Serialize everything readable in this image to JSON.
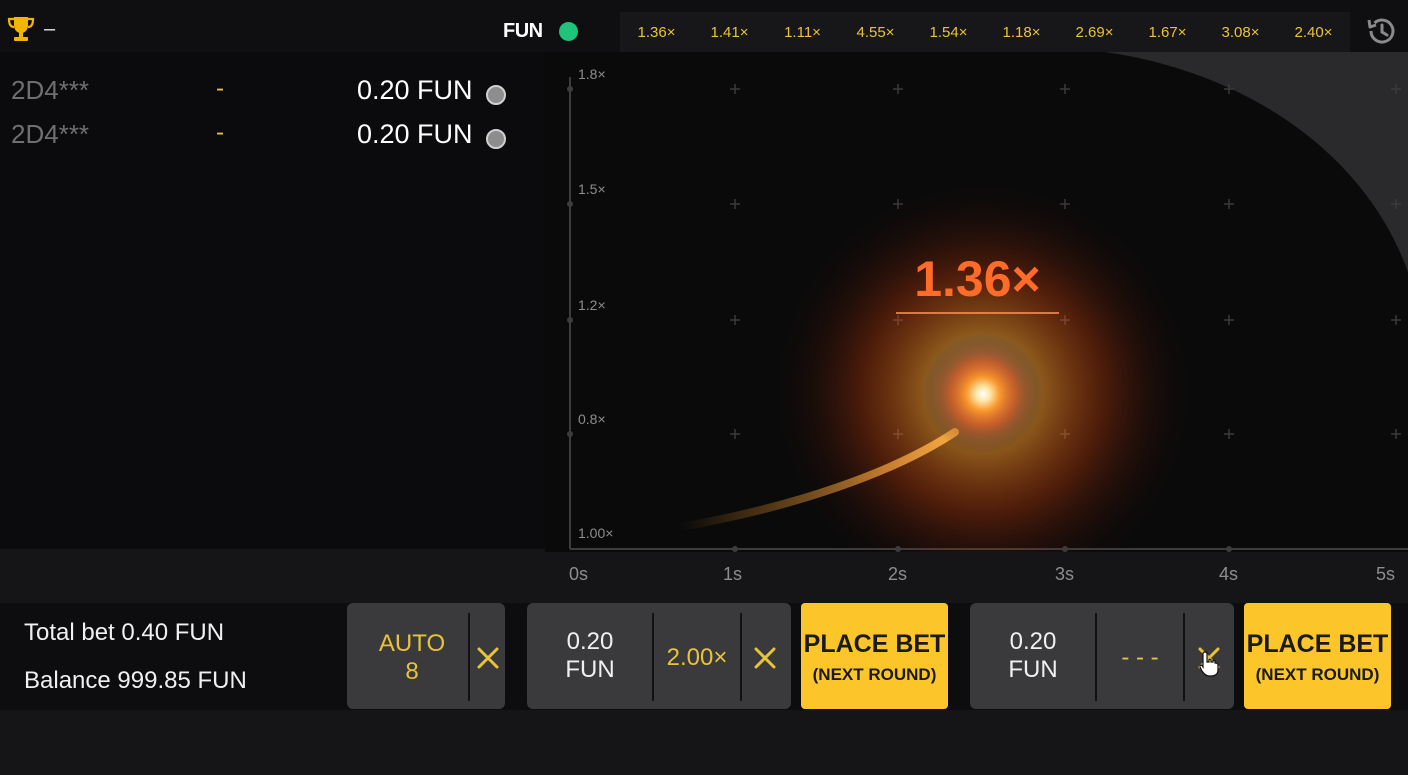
{
  "header": {
    "top_dash": "–",
    "currency": "FUN",
    "history": [
      "1.36×",
      "1.41×",
      "1.11×",
      "4.55×",
      "1.54×",
      "1.18×",
      "2.69×",
      "1.67×",
      "3.08×",
      "2.40×"
    ],
    "icons": [
      "trophy-icon",
      "history-icon"
    ],
    "online_color": "#1ec47a"
  },
  "bets": [
    {
      "user": "2D4***",
      "cashout": "-",
      "amount": "0.20 FUN"
    },
    {
      "user": "2D4***",
      "cashout": "-",
      "amount": "0.20 FUN"
    }
  ],
  "graph": {
    "multiplier": "1.36×",
    "y_labels": [
      "1.8×",
      "1.5×",
      "1.2×",
      "0.8×",
      "1.00×"
    ],
    "x_labels": [
      "0s",
      "1s",
      "2s",
      "3s",
      "4s",
      "5s"
    ],
    "accent_color": "#ff6c2a"
  },
  "footer": {
    "total_bet": "Total bet 0.40 FUN",
    "balance": "Balance 999.85 FUN",
    "auto_label": "AUTO",
    "auto_count": "8",
    "bet1_amount_line1": "0.20",
    "bet1_amount_line2": "FUN",
    "bet1_autocashout": "2.00×",
    "bet2_amount_line1": "0.20",
    "bet2_amount_line2": "FUN",
    "bet2_autocashout": "- - -",
    "place_bet_label": "PLACE BET",
    "place_bet_sub": "(NEXT ROUND)",
    "button_color": "#fcc62b"
  }
}
